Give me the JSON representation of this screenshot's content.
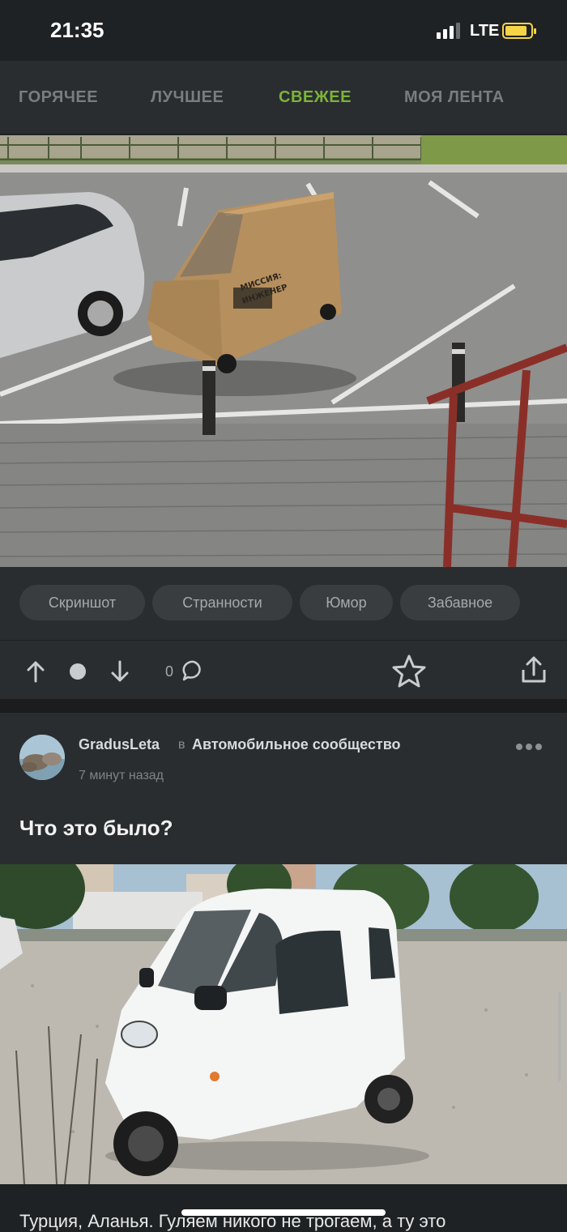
{
  "status_bar": {
    "time": "21:35",
    "network": "LTE",
    "battery_icon": "battery-charging-icon"
  },
  "tabs": [
    {
      "label": "ГОРЯЧЕЕ",
      "active": false
    },
    {
      "label": "ЛУЧШЕЕ",
      "active": false
    },
    {
      "label": "СВЕЖЕЕ",
      "active": true
    },
    {
      "label": "МОЯ ЛЕНТА",
      "active": false
    }
  ],
  "colors": {
    "accent": "#7bb33a",
    "background": "#1f2224",
    "panel": "#2a2d2f"
  },
  "previous_post": {
    "image_text": [
      "МИССИЯ:",
      "ИНЖЕНЕР"
    ],
    "tags": [
      "Скриншот",
      "Странности",
      "Юмор",
      "Забавное"
    ],
    "comment_count": "0"
  },
  "post": {
    "author": "GradusLeta",
    "in_word": "в",
    "community": "Автомобильное сообщество",
    "time_ago": "7 минут назад",
    "title": "Что это было?",
    "body_preview": "Турция, Аланья. Гуляем никого не трогаем, а ту это"
  }
}
